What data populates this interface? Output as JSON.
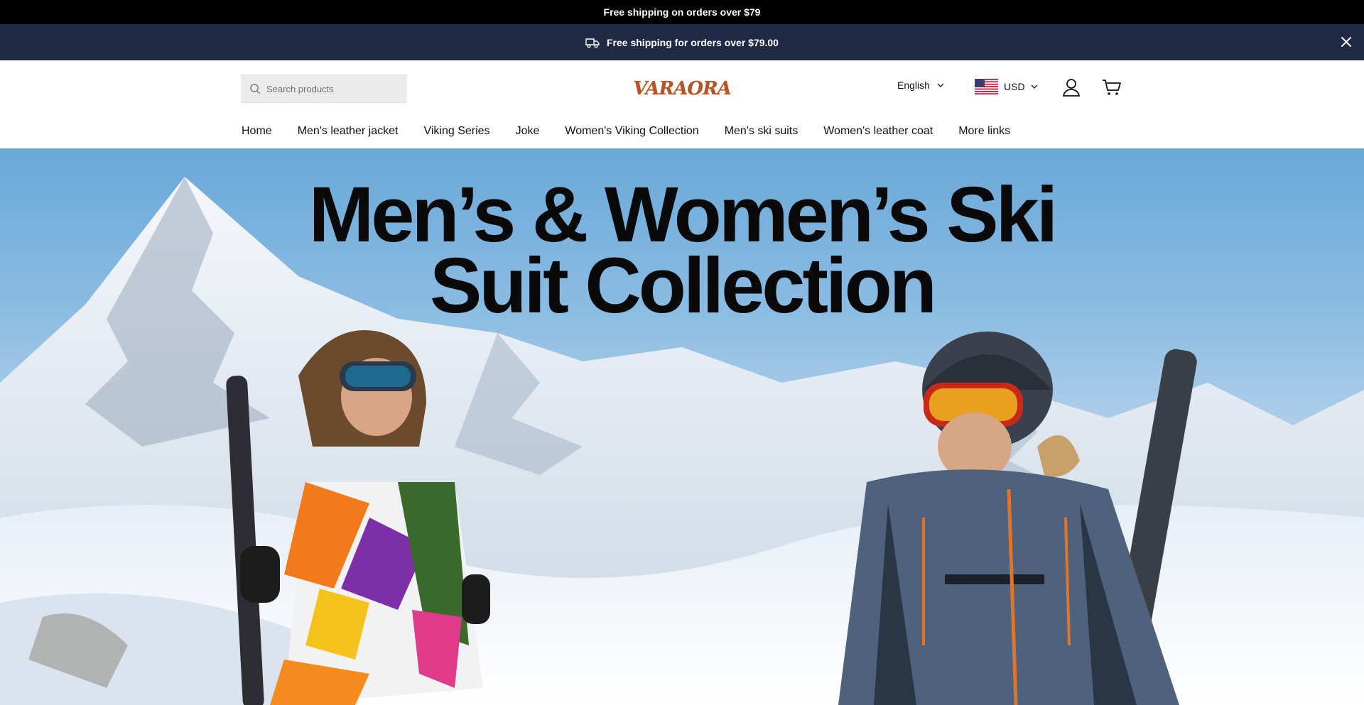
{
  "top_bar": {
    "text": "Free shipping on orders over $79"
  },
  "announcement": {
    "text": "Free shipping for orders over $79.00",
    "icon": "truck-icon",
    "close_icon": "close-icon"
  },
  "header": {
    "search": {
      "placeholder": "Search products",
      "value": ""
    },
    "logo": {
      "text": "VARAORA"
    },
    "language": {
      "selected": "English"
    },
    "currency": {
      "selected": "USD",
      "flag": "us-flag-icon"
    },
    "icons": [
      "account-icon",
      "cart-icon"
    ]
  },
  "nav": {
    "items": [
      {
        "label": "Home"
      },
      {
        "label": "Men's leather jacket"
      },
      {
        "label": "Viking Series"
      },
      {
        "label": "Joke"
      },
      {
        "label": "Women's Viking Collection"
      },
      {
        "label": "Men's ski suits"
      },
      {
        "label": "Women's leather coat"
      },
      {
        "label": "More links"
      }
    ]
  },
  "hero": {
    "title_line1": "Men’s & Women’s Ski",
    "title_line2": "Suit Collection"
  },
  "colors": {
    "announcement_bg": "#1f2a44",
    "top_bar_bg": "#000000",
    "logo": "#b5542a"
  }
}
